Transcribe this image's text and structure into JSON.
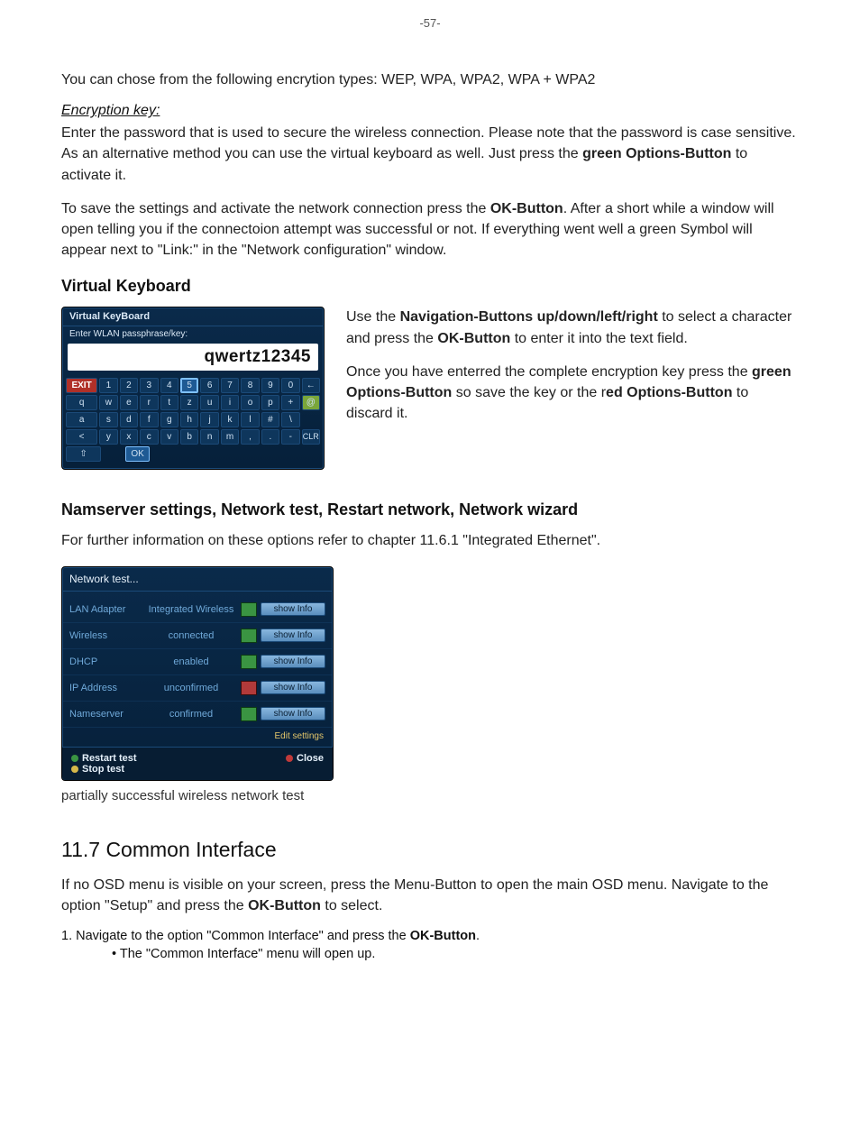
{
  "pageNumber": "-57-",
  "intro": {
    "encryption_types": "You can chose from the following encrytion types: WEP, WPA, WPA2, WPA + WPA2",
    "encryption_key_head": "Encryption key:",
    "encryption_key_p1a": "Enter the password that is used to secure the wireless connection. Please note that the password is case sensitive. As an alternative method you can use the virtual keyboard as well. Just press the ",
    "encryption_key_p1b": "green Options-Button",
    "encryption_key_p1c": " to activate it.",
    "save_p_a": "To save the settings and activate the network connection press the ",
    "save_p_b": "OK-Button",
    "save_p_c": ". After a short while a window will open telling you if the connectoion attempt was successful or not. If everything went well a green Symbol will appear next to \"Link:\" in the \"Network configuration\" window."
  },
  "vkb": {
    "heading": "Virtual Keyboard",
    "title": "Virtual KeyBoard",
    "prompt": "Enter WLAN passphrase/key:",
    "value": "qwertz12345",
    "rows": [
      [
        "EXIT",
        "1",
        "2",
        "3",
        "4",
        "5",
        "6",
        "7",
        "8",
        "9",
        "0",
        "←"
      ],
      [
        "q",
        "w",
        "e",
        "r",
        "t",
        "z",
        "u",
        "i",
        "o",
        "p",
        "+",
        "@"
      ],
      [
        "a",
        "s",
        "d",
        "f",
        "g",
        "h",
        "j",
        "k",
        "l",
        "#",
        "\\",
        ""
      ],
      [
        "<",
        "y",
        "x",
        "c",
        "v",
        "b",
        "n",
        "m",
        ",",
        ".",
        "-",
        "CLR"
      ],
      [
        "⇧",
        "",
        "OK",
        "",
        "",
        "",
        "",
        "",
        "",
        "",
        "",
        ""
      ]
    ],
    "side_p1_a": "Use the ",
    "side_p1_b": "Navigation-Buttons up/down/left/right",
    "side_p1_c": " to select a character and press the ",
    "side_p1_d": "OK-Button",
    "side_p1_e": " to enter it into the text field.",
    "side_p2_a": "Once you have enterred the complete encryption key press the ",
    "side_p2_b": "green Options-Button",
    "side_p2_c": " so save the key or the r",
    "side_p2_d": "ed Options-Button",
    "side_p2_e": " to discard it."
  },
  "nameserver": {
    "heading": "Namserver settings, Network test, Restart network, Network wizard",
    "para": "For further information on these options refer to chapter 11.6.1 \"Integrated Ethernet\"."
  },
  "nettest": {
    "title": "Network test...",
    "rows": [
      {
        "label": "LAN Adapter",
        "value": "Integrated Wireless",
        "ok": true,
        "info": "show Info"
      },
      {
        "label": "Wireless",
        "value": "connected",
        "ok": true,
        "info": "show Info"
      },
      {
        "label": "DHCP",
        "value": "enabled",
        "ok": true,
        "info": "show Info"
      },
      {
        "label": "IP Address",
        "value": "unconfirmed",
        "ok": false,
        "info": "show Info"
      },
      {
        "label": "Nameserver",
        "value": "confirmed",
        "ok": true,
        "info": "show Info"
      }
    ],
    "edit": "Edit settings",
    "restart": "Restart test",
    "stop": "Stop test",
    "close": "Close",
    "caption": "partially successful wireless network test"
  },
  "sec117": {
    "heading": "11.7 Common Interface",
    "p_a": "If no OSD menu is visible on your screen, press the Menu-Button to open the main OSD menu. Navigate to the option \"Setup\" and press the ",
    "p_b": "OK-Button",
    "p_c": " to select.",
    "step1_a": "1. Navigate to the option \"Common Interface\" and press the ",
    "step1_b": "OK-Button",
    "step1_c": ".",
    "bullet": "The \"Common Interface\" menu will open up."
  }
}
